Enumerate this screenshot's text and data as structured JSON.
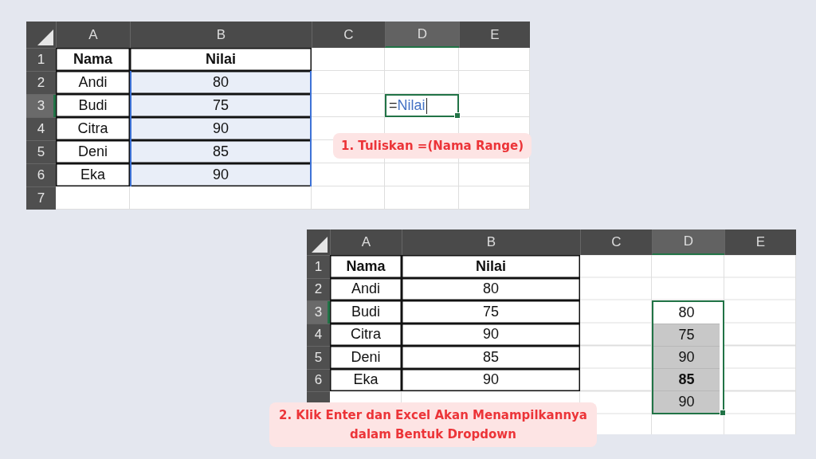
{
  "sheets": [
    {
      "columns": [
        {
          "label": "A",
          "selected": false
        },
        {
          "label": "B",
          "selected": false
        },
        {
          "label": "C",
          "selected": false
        },
        {
          "label": "D",
          "selected": true
        },
        {
          "label": "E",
          "selected": false
        }
      ],
      "range_highlighted": true,
      "rows": [
        {
          "number": "1",
          "kind": "header",
          "selected": false,
          "a": "Nama",
          "b": "Nilai"
        },
        {
          "number": "2",
          "kind": "data",
          "selected": false,
          "a": "Andi",
          "b": "80"
        },
        {
          "number": "3",
          "kind": "data",
          "selected": true,
          "a": "Budi",
          "b": "75",
          "editor": {
            "sign": "=",
            "name": "Nilai"
          }
        },
        {
          "number": "4",
          "kind": "data",
          "selected": false,
          "a": "Citra",
          "b": "90"
        },
        {
          "number": "5",
          "kind": "data",
          "selected": false,
          "a": "Deni",
          "b": "85"
        },
        {
          "number": "6",
          "kind": "data",
          "selected": false,
          "a": "Eka",
          "b": "90"
        },
        {
          "number": "7",
          "kind": "empty",
          "selected": false
        }
      ],
      "callout": [
        "1. Tuliskan =(Nama Range)"
      ]
    },
    {
      "columns": [
        {
          "label": "A",
          "selected": false
        },
        {
          "label": "B",
          "selected": false
        },
        {
          "label": "C",
          "selected": false
        },
        {
          "label": "D",
          "selected": true
        },
        {
          "label": "E",
          "selected": false
        }
      ],
      "range_highlighted": false,
      "rows": [
        {
          "number": "1",
          "kind": "header",
          "selected": false,
          "a": "Nama",
          "b": "Nilai"
        },
        {
          "number": "2",
          "kind": "data",
          "selected": false,
          "a": "Andi",
          "b": "80"
        },
        {
          "number": "3",
          "kind": "data",
          "selected": true,
          "a": "Budi",
          "b": "75"
        },
        {
          "number": "4",
          "kind": "data",
          "selected": false,
          "a": "Citra",
          "b": "90"
        },
        {
          "number": "5",
          "kind": "data",
          "selected": false,
          "a": "Deni",
          "b": "85"
        },
        {
          "number": "6",
          "kind": "data",
          "selected": false,
          "a": "Eka",
          "b": "90"
        },
        {
          "kind": "empty"
        },
        {
          "kind": "empty"
        }
      ],
      "dropdown": [
        {
          "label": "80",
          "shaded": false,
          "bold": false
        },
        {
          "label": "75",
          "shaded": true,
          "bold": false
        },
        {
          "label": "90",
          "shaded": true,
          "bold": false
        },
        {
          "label": "85",
          "shaded": true,
          "bold": true
        },
        {
          "label": "90",
          "shaded": true,
          "bold": false
        }
      ],
      "callout": [
        "2. Klik Enter dan Excel Akan Menampilkannya",
        "dalam Bentuk Dropdown"
      ]
    }
  ]
}
